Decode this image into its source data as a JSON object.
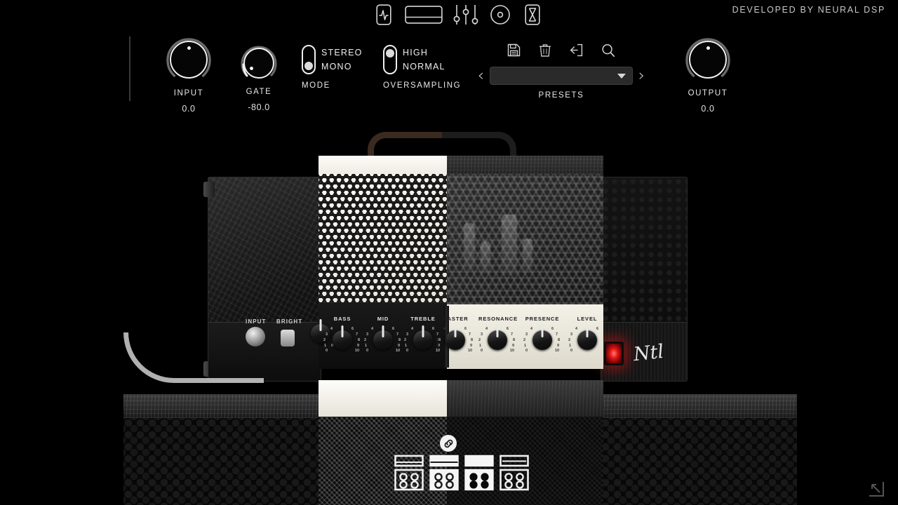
{
  "app": {
    "developer_credit": "DEVELOPED BY NEURAL DSP",
    "accent_red": "#e01414",
    "background": "#000000",
    "panel_white": "#fbf8f2",
    "panel_black": "#1a1a1a"
  },
  "nav": {
    "items": [
      {
        "label": "amp-signal-icon",
        "icon": "waveform-card-icon"
      },
      {
        "label": "cabinet-icon",
        "icon": "cabinet-icon"
      },
      {
        "label": "effects-icon",
        "icon": "sliders-icon"
      },
      {
        "label": "reverb-icon",
        "icon": "disc-icon"
      },
      {
        "label": "metronome-icon",
        "icon": "hourglass-icon"
      }
    ]
  },
  "header": {
    "input": {
      "label": "INPUT",
      "value": "0.0",
      "angle": 0
    },
    "gate": {
      "label": "GATE",
      "value": "-80.0",
      "angle": -135
    },
    "output": {
      "label": "OUTPUT",
      "value": "0.0",
      "angle": 0
    },
    "mode": {
      "label": "MODE",
      "options": [
        "STEREO",
        "MONO"
      ],
      "selected": "MONO"
    },
    "oversampling": {
      "label": "OVERSAMPLING",
      "options": [
        "HIGH",
        "NORMAL"
      ],
      "selected": "HIGH"
    },
    "presets": {
      "label": "PRESETS",
      "current": "",
      "placeholder": "",
      "prev_label": "‹",
      "next_label": "›",
      "actions": [
        {
          "name": "save-preset",
          "icon": "floppy-disk-icon"
        },
        {
          "name": "delete-preset",
          "icon": "trash-icon"
        },
        {
          "name": "import-preset",
          "icon": "import-icon"
        },
        {
          "name": "search-preset",
          "icon": "search-icon"
        }
      ]
    }
  },
  "amp": {
    "background_left": {
      "input_jack_label": "INPUT",
      "bright_switch_label": "BRIGHT"
    },
    "signature": "Ntl",
    "dark_panel_knobs": [
      {
        "label": "BASS",
        "value": 5,
        "min": 0,
        "max": 10
      },
      {
        "label": "MID",
        "value": 5,
        "min": 0,
        "max": 10
      },
      {
        "label": "TREBLE",
        "value": 5,
        "min": 0,
        "max": 10
      }
    ],
    "light_panel_knobs": [
      {
        "label": "MASTER",
        "value": 5,
        "min": 0,
        "max": 10
      },
      {
        "label": "RESONANCE",
        "value": 5,
        "min": 0,
        "max": 10
      },
      {
        "label": "PRESENCE",
        "value": 5,
        "min": 0,
        "max": 10
      },
      {
        "label": "LEVEL",
        "value": 5,
        "min": 0,
        "max": 10
      }
    ],
    "tick_labels": [
      "0",
      "1",
      "2",
      "3",
      "4",
      "5",
      "6",
      "7",
      "8",
      "9",
      "10"
    ]
  },
  "cabinets": {
    "link_icon": "link-icon",
    "options": [
      {
        "name": "cab-slot-1",
        "selected": false
      },
      {
        "name": "cab-slot-2",
        "selected": true
      },
      {
        "name": "cab-slot-3",
        "selected": true
      },
      {
        "name": "cab-slot-4",
        "selected": false
      }
    ]
  },
  "footer": {
    "resize_icon": "resize-handle-icon"
  }
}
